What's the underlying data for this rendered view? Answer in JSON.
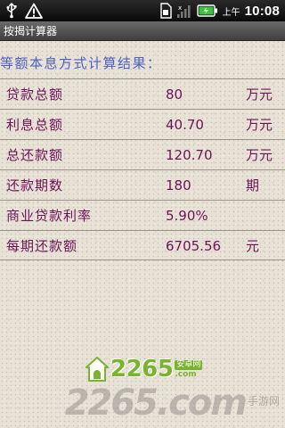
{
  "status_bar": {
    "ampm": "上午",
    "time": "10:08",
    "icons": [
      "usb-icon",
      "warning-icon",
      "sim-icon",
      "no-signal-icon",
      "battery-charging-icon"
    ]
  },
  "app": {
    "title": "按揭计算器"
  },
  "result": {
    "heading": "等额本息方式计算结果：",
    "rows": [
      {
        "label": "贷款总额",
        "value": "80",
        "unit": "万元"
      },
      {
        "label": "利息总额",
        "value": "40.70",
        "unit": "万元"
      },
      {
        "label": "总还款额",
        "value": "120.70",
        "unit": "万元"
      },
      {
        "label": "还款期数",
        "value": "180",
        "unit": "期"
      },
      {
        "label": "商业贷款利率",
        "value": "5.90%",
        "unit": ""
      },
      {
        "label": "每期还款额",
        "value": "6705.56",
        "unit": "元"
      }
    ]
  },
  "watermark": {
    "logo_text": "2265",
    "logo_site_cn": "安卓网",
    "logo_site_com": ".com",
    "big_text": "2265.com",
    "big_cn": "手游网"
  },
  "colors": {
    "heading": "#4b5fc6",
    "row_text": "#6b1357",
    "logo_green": "#7ab32d"
  }
}
